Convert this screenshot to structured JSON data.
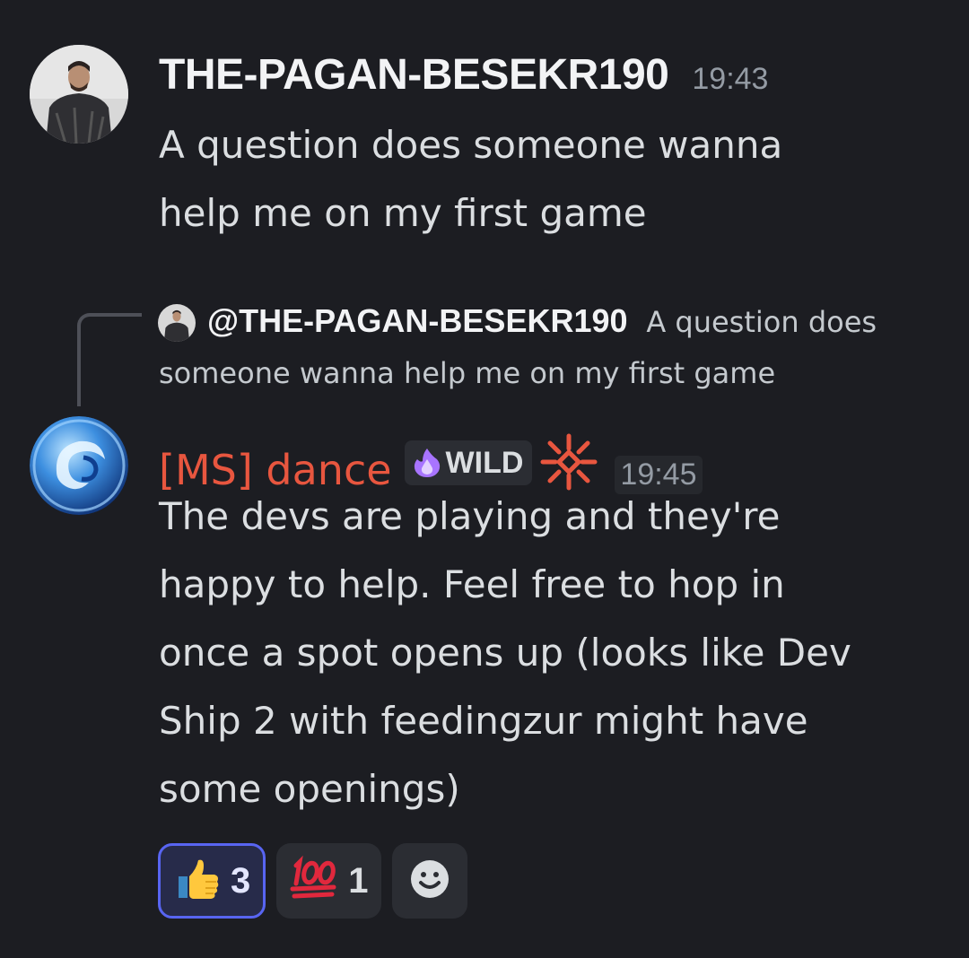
{
  "message_1": {
    "username": "THE-PAGAN-BESEKR190",
    "timestamp": "19:43",
    "lines": [
      "A question does someone wanna",
      "help me on my first game"
    ],
    "avatar_icon": "user-avatar-armored-man"
  },
  "reply_reference": {
    "mention": "@THE-PAGAN-BESEKR190",
    "text_line1": "A question does",
    "text_line2": "someone wanna help me on my first game",
    "avatar_icon": "reply-avatar-armored-man"
  },
  "message_2": {
    "username": "[MS] dance",
    "username_color": "#e8563f",
    "role_tag": "WILD",
    "role_icon": "purple-flame-icon",
    "server_icon": "red-star-burst-icon",
    "timestamp": "19:45",
    "lines": [
      "The devs are playing and they're",
      "happy to help. Feel free to hop in",
      "once a spot opens up (looks like Dev",
      "Ship 2 with feedingzur might have",
      "some openings)"
    ],
    "avatar_icon": "blue-dragon-orb-avatar"
  },
  "reactions": [
    {
      "emoji": "👍",
      "icon": "thumbs-up-icon",
      "count": "3",
      "reacted": true
    },
    {
      "emoji": "💯",
      "icon": "hundred-points-icon",
      "count": "1",
      "reacted": false
    }
  ],
  "add_reaction_icon": "smiley-add-reaction-icon",
  "colors": {
    "background": "#1c1d22",
    "accent": "#5865f2"
  }
}
